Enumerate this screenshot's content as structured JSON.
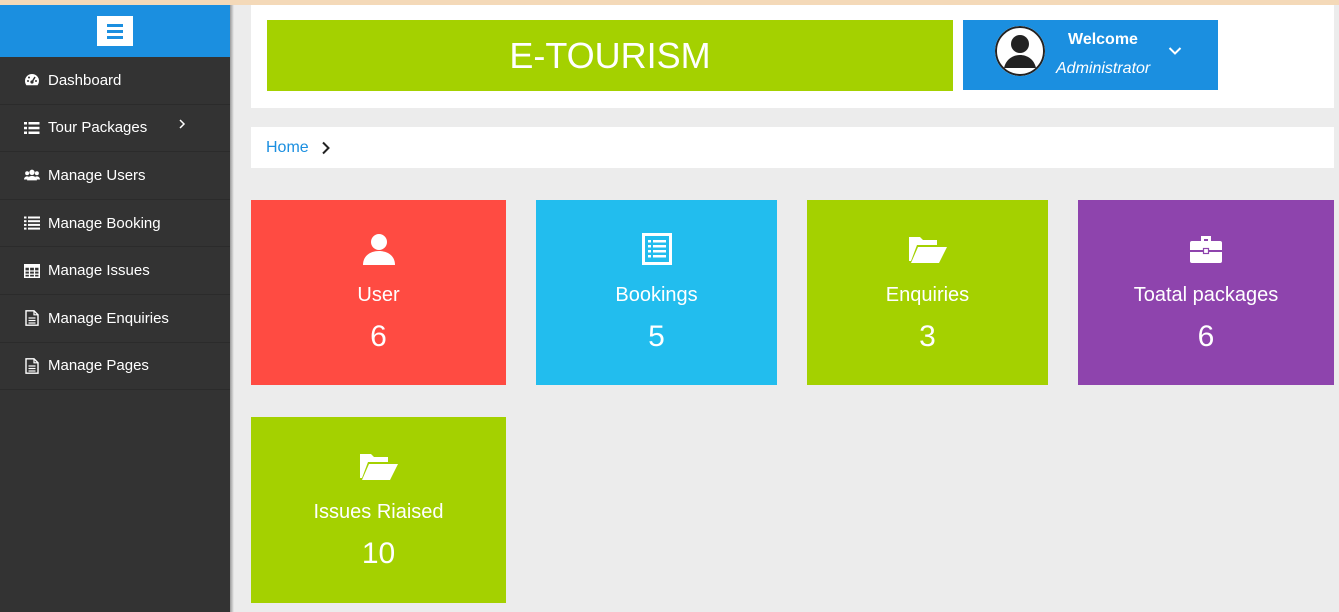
{
  "sidebar": {
    "items": [
      {
        "label": "Dashboard",
        "icon": "dashboard-icon"
      },
      {
        "label": "Tour Packages",
        "icon": "list-icon"
      },
      {
        "label": "Manage Users",
        "icon": "users-icon"
      },
      {
        "label": "Manage Booking",
        "icon": "list-icon"
      },
      {
        "label": "Manage Issues",
        "icon": "table-icon"
      },
      {
        "label": "Manage Enquiries",
        "icon": "file-icon"
      },
      {
        "label": "Manage Pages",
        "icon": "file-icon"
      }
    ]
  },
  "header": {
    "brand": "E-TOURISM",
    "welcome": "Welcome",
    "role": "Administrator"
  },
  "breadcrumb": {
    "home": "Home"
  },
  "cards": [
    {
      "label": "User",
      "value": "6",
      "icon": "user-icon",
      "color": "#ff4b42"
    },
    {
      "label": "Bookings",
      "value": "5",
      "icon": "list-alt-icon",
      "color": "#22bdee"
    },
    {
      "label": "Enquiries",
      "value": "3",
      "icon": "folder-open-icon",
      "color": "#a4d100"
    },
    {
      "label": "Toatal packages",
      "value": "6",
      "icon": "briefcase-icon",
      "color": "#8e44ad"
    },
    {
      "label": "Issues Riaised",
      "value": "10",
      "icon": "folder-open-icon",
      "color": "#a4d100"
    }
  ],
  "colors": {
    "primary": "#1b8fe0",
    "sidebar": "#333333",
    "green": "#a4d100"
  }
}
